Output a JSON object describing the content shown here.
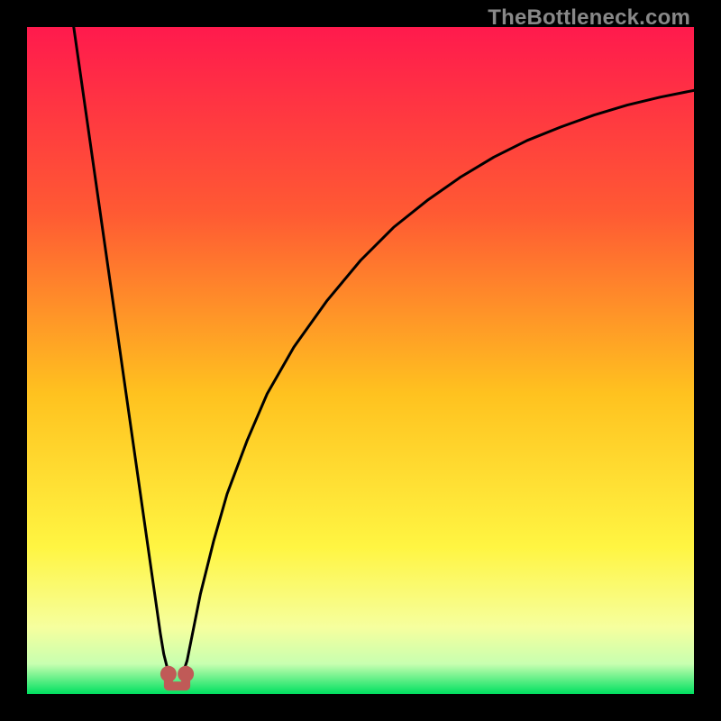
{
  "watermark": "TheBottleneck.com",
  "chart_data": {
    "type": "line",
    "title": "",
    "xlabel": "",
    "ylabel": "",
    "xlim": [
      0,
      100
    ],
    "ylim": [
      0,
      100
    ],
    "grid": false,
    "legend": false,
    "background_gradient_stops": [
      {
        "offset": 0.0,
        "color": "#ff1a4d"
      },
      {
        "offset": 0.28,
        "color": "#ff5a33"
      },
      {
        "offset": 0.55,
        "color": "#ffc21f"
      },
      {
        "offset": 0.78,
        "color": "#fff542"
      },
      {
        "offset": 0.9,
        "color": "#f6ff9e"
      },
      {
        "offset": 0.955,
        "color": "#c8ffb0"
      },
      {
        "offset": 1.0,
        "color": "#00e060"
      }
    ],
    "series": [
      {
        "name": "left-branch",
        "x": [
          7,
          8,
          9,
          10,
          11,
          12,
          13,
          14,
          15,
          16,
          17,
          18,
          19,
          20,
          20.5,
          21,
          21.5
        ],
        "y": [
          100,
          93,
          86,
          79,
          72,
          65,
          58,
          51,
          44,
          37,
          30,
          23,
          16,
          9,
          6,
          4,
          3.5
        ]
      },
      {
        "name": "right-branch",
        "x": [
          23.5,
          24,
          25,
          26,
          28,
          30,
          33,
          36,
          40,
          45,
          50,
          55,
          60,
          65,
          70,
          75,
          80,
          85,
          90,
          95,
          100
        ],
        "y": [
          3.5,
          5,
          10,
          15,
          23,
          30,
          38,
          45,
          52,
          59,
          65,
          70,
          74,
          77.5,
          80.5,
          83,
          85,
          86.8,
          88.3,
          89.5,
          90.5
        ]
      },
      {
        "name": "bottom-marker",
        "marker_points": [
          {
            "x": 21.2,
            "y": 3.0
          },
          {
            "x": 23.8,
            "y": 3.0
          }
        ],
        "marker_color": "#c05a57",
        "connector": {
          "x1": 21.2,
          "y1": 2.0,
          "x2": 23.8,
          "y2": 2.0
        }
      }
    ]
  }
}
